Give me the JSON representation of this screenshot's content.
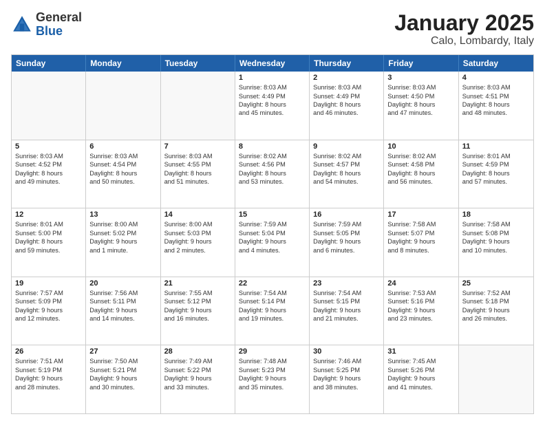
{
  "header": {
    "logo_general": "General",
    "logo_blue": "Blue",
    "title": "January 2025",
    "subtitle": "Calo, Lombardy, Italy"
  },
  "calendar": {
    "days": [
      "Sunday",
      "Monday",
      "Tuesday",
      "Wednesday",
      "Thursday",
      "Friday",
      "Saturday"
    ],
    "weeks": [
      [
        {
          "day": "",
          "info": ""
        },
        {
          "day": "",
          "info": ""
        },
        {
          "day": "",
          "info": ""
        },
        {
          "day": "1",
          "info": "Sunrise: 8:03 AM\nSunset: 4:49 PM\nDaylight: 8 hours\nand 45 minutes."
        },
        {
          "day": "2",
          "info": "Sunrise: 8:03 AM\nSunset: 4:49 PM\nDaylight: 8 hours\nand 46 minutes."
        },
        {
          "day": "3",
          "info": "Sunrise: 8:03 AM\nSunset: 4:50 PM\nDaylight: 8 hours\nand 47 minutes."
        },
        {
          "day": "4",
          "info": "Sunrise: 8:03 AM\nSunset: 4:51 PM\nDaylight: 8 hours\nand 48 minutes."
        }
      ],
      [
        {
          "day": "5",
          "info": "Sunrise: 8:03 AM\nSunset: 4:52 PM\nDaylight: 8 hours\nand 49 minutes."
        },
        {
          "day": "6",
          "info": "Sunrise: 8:03 AM\nSunset: 4:54 PM\nDaylight: 8 hours\nand 50 minutes."
        },
        {
          "day": "7",
          "info": "Sunrise: 8:03 AM\nSunset: 4:55 PM\nDaylight: 8 hours\nand 51 minutes."
        },
        {
          "day": "8",
          "info": "Sunrise: 8:02 AM\nSunset: 4:56 PM\nDaylight: 8 hours\nand 53 minutes."
        },
        {
          "day": "9",
          "info": "Sunrise: 8:02 AM\nSunset: 4:57 PM\nDaylight: 8 hours\nand 54 minutes."
        },
        {
          "day": "10",
          "info": "Sunrise: 8:02 AM\nSunset: 4:58 PM\nDaylight: 8 hours\nand 56 minutes."
        },
        {
          "day": "11",
          "info": "Sunrise: 8:01 AM\nSunset: 4:59 PM\nDaylight: 8 hours\nand 57 minutes."
        }
      ],
      [
        {
          "day": "12",
          "info": "Sunrise: 8:01 AM\nSunset: 5:00 PM\nDaylight: 8 hours\nand 59 minutes."
        },
        {
          "day": "13",
          "info": "Sunrise: 8:00 AM\nSunset: 5:02 PM\nDaylight: 9 hours\nand 1 minute."
        },
        {
          "day": "14",
          "info": "Sunrise: 8:00 AM\nSunset: 5:03 PM\nDaylight: 9 hours\nand 2 minutes."
        },
        {
          "day": "15",
          "info": "Sunrise: 7:59 AM\nSunset: 5:04 PM\nDaylight: 9 hours\nand 4 minutes."
        },
        {
          "day": "16",
          "info": "Sunrise: 7:59 AM\nSunset: 5:05 PM\nDaylight: 9 hours\nand 6 minutes."
        },
        {
          "day": "17",
          "info": "Sunrise: 7:58 AM\nSunset: 5:07 PM\nDaylight: 9 hours\nand 8 minutes."
        },
        {
          "day": "18",
          "info": "Sunrise: 7:58 AM\nSunset: 5:08 PM\nDaylight: 9 hours\nand 10 minutes."
        }
      ],
      [
        {
          "day": "19",
          "info": "Sunrise: 7:57 AM\nSunset: 5:09 PM\nDaylight: 9 hours\nand 12 minutes."
        },
        {
          "day": "20",
          "info": "Sunrise: 7:56 AM\nSunset: 5:11 PM\nDaylight: 9 hours\nand 14 minutes."
        },
        {
          "day": "21",
          "info": "Sunrise: 7:55 AM\nSunset: 5:12 PM\nDaylight: 9 hours\nand 16 minutes."
        },
        {
          "day": "22",
          "info": "Sunrise: 7:54 AM\nSunset: 5:14 PM\nDaylight: 9 hours\nand 19 minutes."
        },
        {
          "day": "23",
          "info": "Sunrise: 7:54 AM\nSunset: 5:15 PM\nDaylight: 9 hours\nand 21 minutes."
        },
        {
          "day": "24",
          "info": "Sunrise: 7:53 AM\nSunset: 5:16 PM\nDaylight: 9 hours\nand 23 minutes."
        },
        {
          "day": "25",
          "info": "Sunrise: 7:52 AM\nSunset: 5:18 PM\nDaylight: 9 hours\nand 26 minutes."
        }
      ],
      [
        {
          "day": "26",
          "info": "Sunrise: 7:51 AM\nSunset: 5:19 PM\nDaylight: 9 hours\nand 28 minutes."
        },
        {
          "day": "27",
          "info": "Sunrise: 7:50 AM\nSunset: 5:21 PM\nDaylight: 9 hours\nand 30 minutes."
        },
        {
          "day": "28",
          "info": "Sunrise: 7:49 AM\nSunset: 5:22 PM\nDaylight: 9 hours\nand 33 minutes."
        },
        {
          "day": "29",
          "info": "Sunrise: 7:48 AM\nSunset: 5:23 PM\nDaylight: 9 hours\nand 35 minutes."
        },
        {
          "day": "30",
          "info": "Sunrise: 7:46 AM\nSunset: 5:25 PM\nDaylight: 9 hours\nand 38 minutes."
        },
        {
          "day": "31",
          "info": "Sunrise: 7:45 AM\nSunset: 5:26 PM\nDaylight: 9 hours\nand 41 minutes."
        },
        {
          "day": "",
          "info": ""
        }
      ]
    ]
  }
}
